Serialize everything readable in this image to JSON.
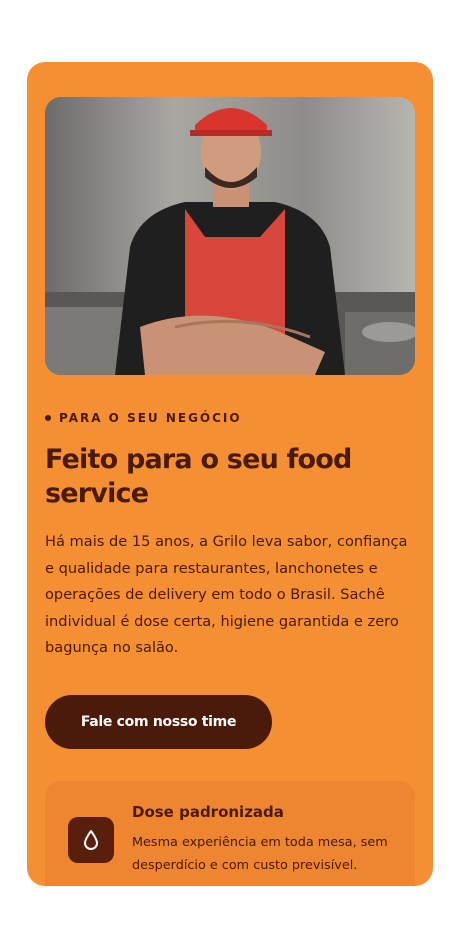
{
  "hero": {
    "image_alt": "Chef de avental vermelho em cozinha profissional"
  },
  "section": {
    "eyebrow": "PARA O SEU NEGÓCIO",
    "title": "Feito para o seu food service",
    "description": "Há mais de 15 anos, a Grilo leva sabor, confiança e qualidade para restaurantes, lanchonetes e operações de delivery em todo o Brasil. Sachê individual é dose certa, higiene garantida e zero bagunça no salão.",
    "cta_label": "Fale com nosso time"
  },
  "feature": {
    "icon": "drop-icon",
    "title": "Dose padronizada",
    "description": "Mesma experiência em toda mesa, sem desperdício e com custo previsível."
  },
  "colors": {
    "card_bg": "#f58f33",
    "text_dark": "#4a1a0a",
    "button_bg": "#4a1a0a",
    "feature_bg": "#ee8530"
  }
}
